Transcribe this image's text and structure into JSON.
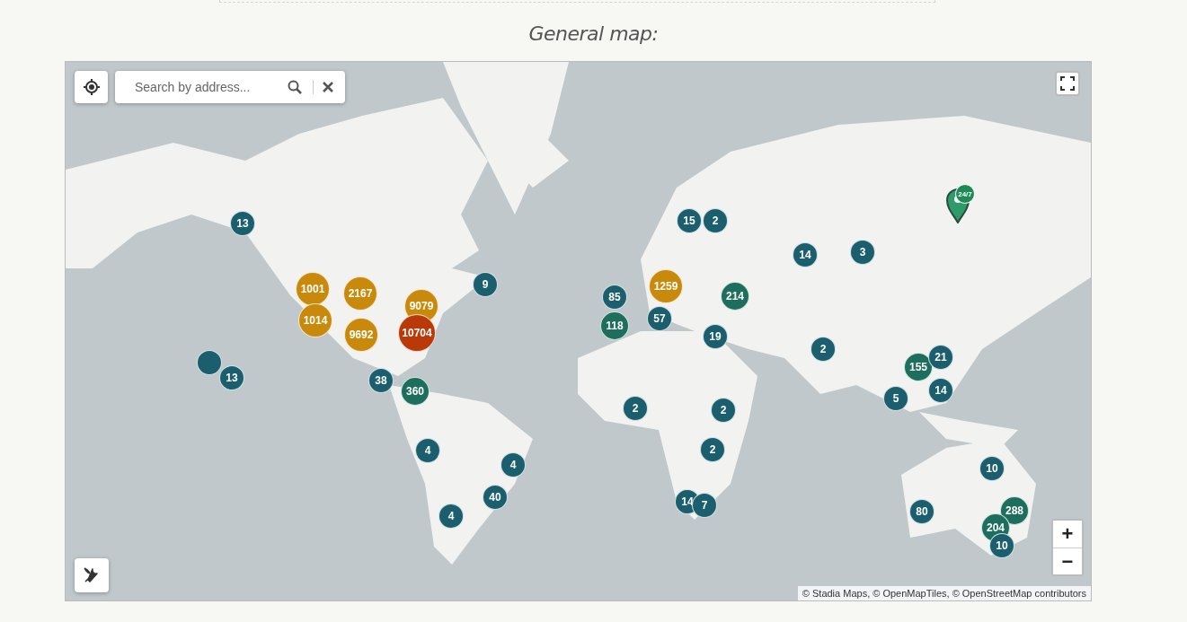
{
  "heading": "General map:",
  "map": {
    "kind": "picture",
    "search": {
      "placeholder": "Search by address..."
    },
    "zoom": {
      "in": "+",
      "out": "−"
    },
    "attribution": "© Stadia Maps, © OpenMapTiles, © OpenStreetMap contributors",
    "pin": {
      "badge": "24/7"
    },
    "clusters": [
      {
        "count": "13",
        "color": "#1b5f6e"
      },
      {
        "count": "1001",
        "color": "#c98a0c"
      },
      {
        "count": "2167",
        "color": "#c98a0c"
      },
      {
        "count": "9079",
        "color": "#c98a0c"
      },
      {
        "count": "1014",
        "color": "#c98a0c"
      },
      {
        "count": "9692",
        "color": "#c98a0c"
      },
      {
        "count": "10704",
        "color": "#b93a08"
      },
      {
        "count": "9",
        "color": "#1b5f6e"
      },
      {
        "color": "#1b5f6e"
      },
      {
        "count": "13",
        "color": "#1b5f6e"
      },
      {
        "count": "38",
        "color": "#1b5f6e"
      },
      {
        "count": "360",
        "color": "#1d6e5c"
      },
      {
        "count": "4",
        "color": "#1b5f6e"
      },
      {
        "count": "4",
        "color": "#1b5f6e"
      },
      {
        "count": "40",
        "color": "#1b5f6e"
      },
      {
        "count": "4",
        "color": "#1b5f6e"
      },
      {
        "count": "15",
        "color": "#1b5f6e"
      },
      {
        "count": "2",
        "color": "#1b5f6e"
      },
      {
        "count": "14",
        "color": "#1b5f6e"
      },
      {
        "count": "3",
        "color": "#1b5f6e"
      },
      {
        "count": "85",
        "color": "#1b5f6e"
      },
      {
        "count": "1259",
        "color": "#c98a0c"
      },
      {
        "count": "214",
        "color": "#1d6e5c"
      },
      {
        "count": "118",
        "color": "#1d6e5c"
      },
      {
        "count": "57",
        "color": "#1b5f6e"
      },
      {
        "count": "19",
        "color": "#1b5f6e"
      },
      {
        "count": "2",
        "color": "#1b5f6e"
      },
      {
        "count": "155",
        "color": "#1d6e5c"
      },
      {
        "count": "21",
        "color": "#1b5f6e"
      },
      {
        "count": "5",
        "color": "#1b5f6e"
      },
      {
        "count": "14",
        "color": "#1b5f6e"
      },
      {
        "count": "2",
        "color": "#1b5f6e"
      },
      {
        "count": "2",
        "color": "#1b5f6e"
      },
      {
        "count": "2",
        "color": "#1b5f6e"
      },
      {
        "count": "14",
        "color": "#1b5f6e"
      },
      {
        "count": "7",
        "color": "#1b5f6e"
      },
      {
        "count": "10",
        "color": "#1b5f6e"
      },
      {
        "count": "80",
        "color": "#1b5f6e"
      },
      {
        "count": "288",
        "color": "#1d6e5c"
      },
      {
        "count": "204",
        "color": "#1d6e5c"
      },
      {
        "count": "10",
        "color": "#1b5f6e"
      }
    ]
  }
}
